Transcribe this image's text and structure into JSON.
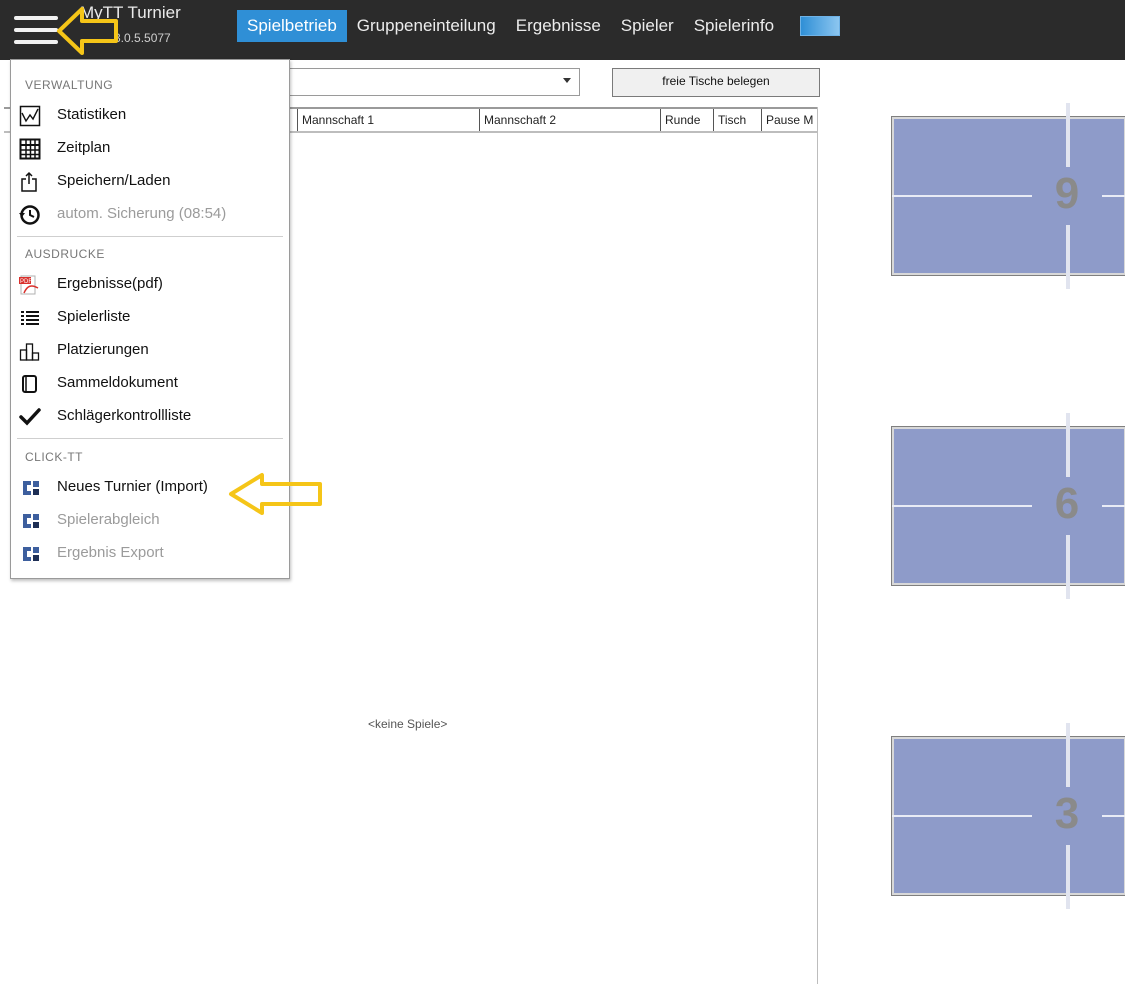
{
  "app": {
    "title": "MyTT Turnier",
    "version": "3.0.5.5077"
  },
  "tabs": [
    {
      "label": "Spielbetrieb",
      "active": true
    },
    {
      "label": "Gruppeneinteilung"
    },
    {
      "label": "Ergebnisse"
    },
    {
      "label": "Spieler"
    },
    {
      "label": "Spielerinfo"
    }
  ],
  "toolbar": {
    "combo_value": "",
    "free_tables_button": "freie Tische belegen"
  },
  "grid": {
    "columns": [
      "",
      "Mannschaft 1",
      "Mannschaft 2",
      "Runde",
      "Tisch",
      "Pause M"
    ],
    "empty_text": "<keine Spiele>"
  },
  "tables": [
    {
      "number": "9"
    },
    {
      "number": "6"
    },
    {
      "number": "3"
    }
  ],
  "menu": {
    "sections": {
      "verwaltung": "VERWALTUNG",
      "ausdrucke": "AUSDRUCKE",
      "clicktt": "CLICK-TT"
    },
    "items": {
      "statistiken": "Statistiken",
      "zeitplan": "Zeitplan",
      "speichern": "Speichern/Laden",
      "sicherung": "autom. Sicherung (08:54)",
      "ergebnisse_pdf": "Ergebnisse(pdf)",
      "spielerliste": "Spielerliste",
      "platzierungen": "Platzierungen",
      "sammeldokument": "Sammeldokument",
      "schlaeger": "Schlägerkontrollliste",
      "neues_turnier": "Neues Turnier (Import)",
      "spielerabgleich": "Spielerabgleich",
      "ergebnis_export": "Ergebnis Export"
    },
    "icons": {
      "statistiken": "chart-icon",
      "zeitplan": "grid-icon",
      "speichern": "share-icon",
      "sicherung": "history-icon",
      "ergebnisse_pdf": "pdf-icon",
      "spielerliste": "list-icon",
      "platzierungen": "podium-icon",
      "sammeldokument": "document-icon",
      "schlaeger": "checkmark-icon",
      "clicktt": "clicktt-logo-icon"
    }
  },
  "colors": {
    "topbar": "#2b2b2b",
    "active_tab": "#2f8fd6",
    "table": "#8e9bc9",
    "highlight_arrow": "#f5c518",
    "clicktt_blue": "#3d5f9e"
  }
}
